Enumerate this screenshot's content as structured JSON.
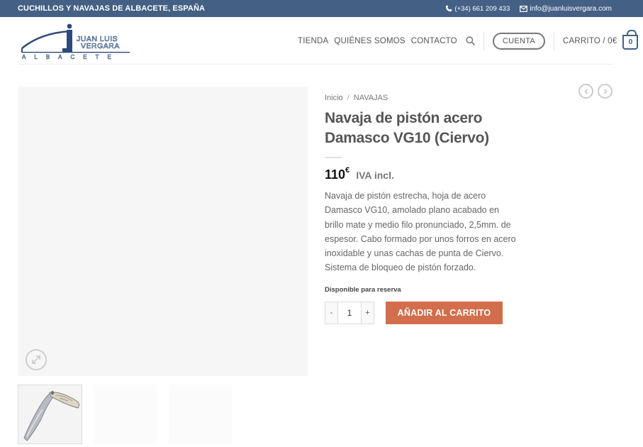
{
  "topbar": {
    "tagline": "CUCHILLOS Y NAVAJAS DE ALBACETE, ESPAÑA",
    "phone": "(+34) 661 209 433",
    "email": "info@juanluisvergara.com",
    "phone_icon": "phone-icon",
    "email_icon": "envelope-icon"
  },
  "logo": {
    "line1": "JUAN LUIS",
    "line2": "VERGARA",
    "line3": "ALBACETE"
  },
  "nav": {
    "items": [
      "TIENDA",
      "QUIÉNES SOMOS",
      "CONTACTO"
    ],
    "account": "CUENTA",
    "cart_label": "CARRITO / 0€",
    "cart_count": "0"
  },
  "breadcrumb": {
    "home": "Inicio",
    "divider": "/",
    "category": "NAVAJAS"
  },
  "product": {
    "title": "Navaja de pistón acero Damasco VG10 (Ciervo)",
    "price": "110",
    "currency": "€",
    "tax_label": "IVA incl.",
    "description": "Navaja de pistón estrecha, hoja de acero Damasco VG10, amolado plano acabado en brillo mate y medio filo pronunciado, 2,5mm. de espesor. Cabo formado por unos forros en acero inoxidable y unas cachas de punta de Ciervo. Sistema de bloqueo de pistón forzado.",
    "stock": "Disponible para reserva"
  },
  "cart_form": {
    "minus": "-",
    "quantity": "1",
    "plus": "+",
    "add_button": "AÑADIR AL CARRITO"
  },
  "colors": {
    "primary": "#446084",
    "accent": "#d26e4b"
  }
}
